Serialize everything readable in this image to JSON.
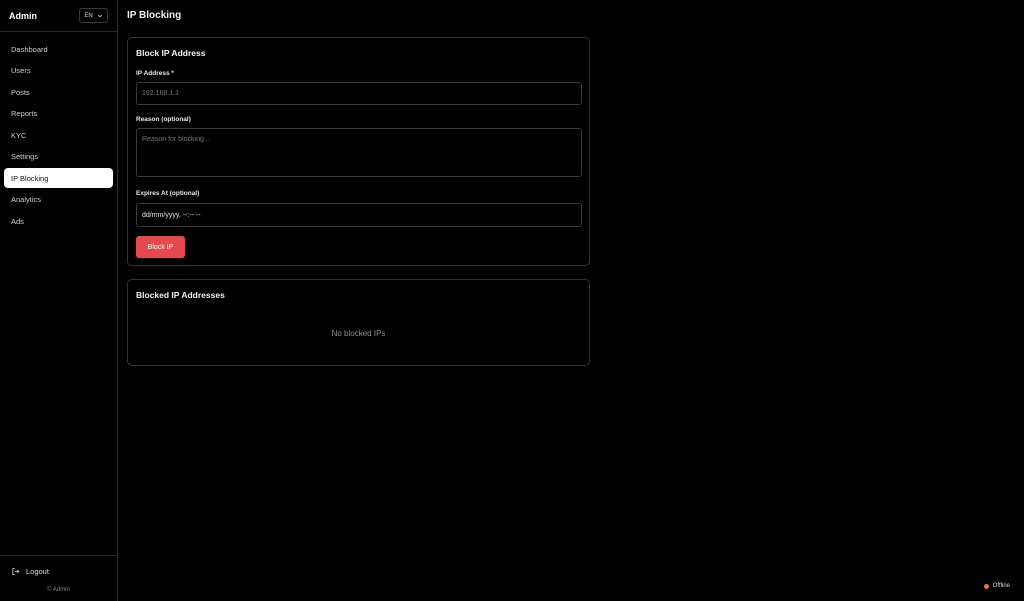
{
  "sidebar": {
    "brand": "Admin",
    "language": "EN",
    "items": [
      {
        "label": "Dashboard"
      },
      {
        "label": "Users"
      },
      {
        "label": "Posts"
      },
      {
        "label": "Reports"
      },
      {
        "label": "KYC"
      },
      {
        "label": "Settings"
      },
      {
        "label": "IP Blocking",
        "active": true
      },
      {
        "label": "Analytics"
      },
      {
        "label": "Ads"
      }
    ],
    "logout_label": "Logout",
    "copyright": "© Admin"
  },
  "main": {
    "page_title": "IP Blocking",
    "block_form": {
      "title": "Block IP Address",
      "ip_label": "IP Address *",
      "ip_placeholder": "192.168.1.1",
      "reason_label": "Reason (optional)",
      "reason_placeholder": "Reason for blocking...",
      "expires_label": "Expires At (optional)",
      "expires_value": "dd/mm/yyyy, --:-- --",
      "submit_label": "Block IP"
    },
    "blocked_list": {
      "title": "Blocked IP Addresses",
      "empty_text": "No blocked IPs"
    }
  },
  "status": {
    "label": "Offline",
    "color": "#e87a2e"
  },
  "colors": {
    "accent_button": "#e5484d",
    "active_nav": "#ffffff"
  }
}
